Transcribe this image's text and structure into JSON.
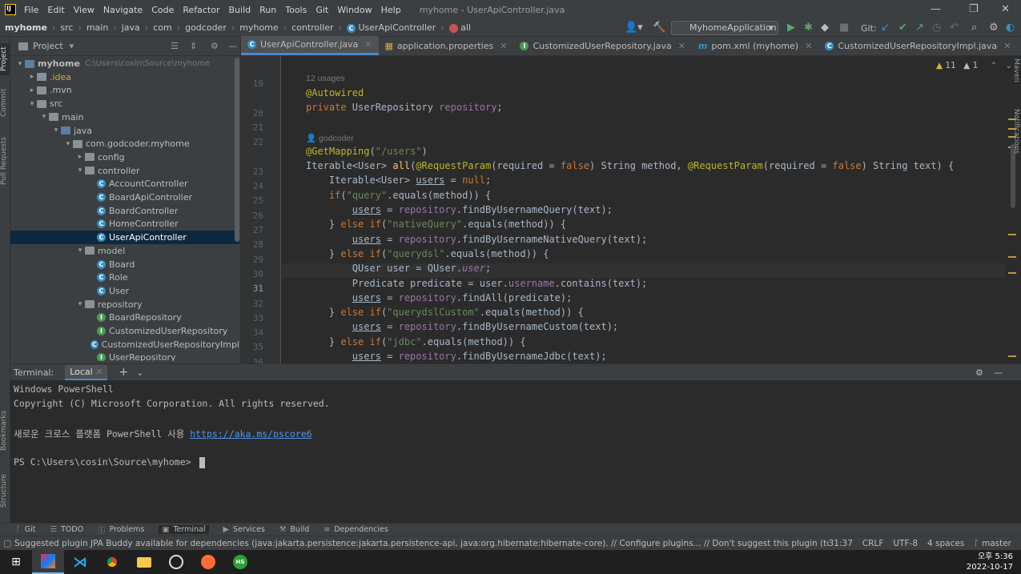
{
  "titlebar": {
    "menu": [
      "File",
      "Edit",
      "View",
      "Navigate",
      "Code",
      "Refactor",
      "Build",
      "Run",
      "Tools",
      "Git",
      "Window",
      "Help"
    ],
    "window_title": "myhome - UserApiController.java"
  },
  "navbar": {
    "crumbs": [
      "myhome",
      "src",
      "main",
      "java",
      "com",
      "godcoder",
      "myhome",
      "controller",
      "UserApiController",
      "all"
    ],
    "run_config": "MyhomeApplication",
    "git_label": "Git:"
  },
  "sidebar_labels": {
    "project": "Project",
    "commit": "Commit",
    "pull_requests": "Pull Requests",
    "bookmarks": "Bookmarks",
    "structure": "Structure"
  },
  "right_labels": {
    "maven": "Maven",
    "notifications": "Notifications"
  },
  "project": {
    "title": "Project",
    "tree": [
      {
        "label": "myhome",
        "extra": "C:\\Users\\cosin\\Source\\myhome",
        "indent": 0,
        "arrow": "v",
        "icon": "folder-blue",
        "bold": true
      },
      {
        "label": ".idea",
        "indent": 1,
        "arrow": ">",
        "icon": "folder",
        "color": "#d0a93d"
      },
      {
        "label": ".mvn",
        "indent": 1,
        "arrow": ">",
        "icon": "folder"
      },
      {
        "label": "src",
        "indent": 1,
        "arrow": "v",
        "icon": "folder"
      },
      {
        "label": "main",
        "indent": 2,
        "arrow": "v",
        "icon": "folder"
      },
      {
        "label": "java",
        "indent": 3,
        "arrow": "v",
        "icon": "folder-blue"
      },
      {
        "label": "com.godcoder.myhome",
        "indent": 4,
        "arrow": "v",
        "icon": "folder"
      },
      {
        "label": "config",
        "indent": 5,
        "arrow": ">",
        "icon": "folder"
      },
      {
        "label": "controller",
        "indent": 5,
        "arrow": "v",
        "icon": "folder"
      },
      {
        "label": "AccountController",
        "indent": 6,
        "arrow": "",
        "icon": "class"
      },
      {
        "label": "BoardApiController",
        "indent": 6,
        "arrow": "",
        "icon": "class"
      },
      {
        "label": "BoardController",
        "indent": 6,
        "arrow": "",
        "icon": "class"
      },
      {
        "label": "HomeController",
        "indent": 6,
        "arrow": "",
        "icon": "class"
      },
      {
        "label": "UserApiController",
        "indent": 6,
        "arrow": "",
        "icon": "class",
        "selected": true
      },
      {
        "label": "model",
        "indent": 5,
        "arrow": "v",
        "icon": "folder"
      },
      {
        "label": "Board",
        "indent": 6,
        "arrow": "",
        "icon": "class"
      },
      {
        "label": "Role",
        "indent": 6,
        "arrow": "",
        "icon": "class"
      },
      {
        "label": "User",
        "indent": 6,
        "arrow": "",
        "icon": "class"
      },
      {
        "label": "repository",
        "indent": 5,
        "arrow": "v",
        "icon": "folder"
      },
      {
        "label": "BoardRepository",
        "indent": 6,
        "arrow": "",
        "icon": "interface"
      },
      {
        "label": "CustomizedUserRepository",
        "indent": 6,
        "arrow": "",
        "icon": "interface"
      },
      {
        "label": "CustomizedUserRepositoryImpl",
        "indent": 6,
        "arrow": "",
        "icon": "class"
      },
      {
        "label": "UserRepository",
        "indent": 6,
        "arrow": "",
        "icon": "interface"
      }
    ]
  },
  "tabs": [
    {
      "label": "UserApiController.java",
      "icon": "class",
      "active": true
    },
    {
      "label": "application.properties",
      "icon": "props"
    },
    {
      "label": "CustomizedUserRepository.java",
      "icon": "interface"
    },
    {
      "label": "pom.xml (myhome)",
      "icon": "maven"
    },
    {
      "label": "CustomizedUserRepositoryImpl.java",
      "icon": "class"
    }
  ],
  "inspections": {
    "warnings": "11",
    "weak": "1"
  },
  "code_lines": [
    {
      "n": "19",
      "html": ""
    },
    {
      "hint": "12 usages"
    },
    {
      "n": "20",
      "html": "<span class='ann'>@Autowired</span>"
    },
    {
      "n": "21",
      "html": "<span class='kw'>private </span>UserRepository <span class='fld'>repository</span>;"
    },
    {
      "n": "22",
      "html": ""
    },
    {
      "hint": "godcoder"
    },
    {
      "n": "23",
      "html": "<span class='ann'>@GetMapping</span>(<span class='str'>\"/users\"</span>)"
    },
    {
      "n": "24",
      "html": "Iterable&lt;User&gt; <span style='color:#ffc66d'>all</span>(<span class='ann'>@RequestParam</span>(required = <span class='kw'>false</span>) String method, <span class='ann'>@RequestParam</span>(required = <span class='kw'>false</span>) String text) {"
    },
    {
      "n": "25",
      "html": "    Iterable&lt;User&gt; <span class='ul'>users</span> = <span class='kw'>null</span>;"
    },
    {
      "n": "26",
      "html": "    <span class='kw'>if</span>(<span class='str'>\"query\"</span>.equals(method)) {"
    },
    {
      "n": "27",
      "html": "        <span class='ul'>users</span> = <span class='fld'>repository</span>.findByUsernameQuery(text);"
    },
    {
      "n": "28",
      "html": "    } <span class='kw'>else if</span>(<span class='str'>\"nativeQuery\"</span>.equals(method)) {"
    },
    {
      "n": "29",
      "html": "        <span class='ul'>users</span> = <span class='fld'>repository</span>.findByUsernameNativeQuery(text);"
    },
    {
      "n": "30",
      "html": "    } <span class='kw'>else if</span>(<span class='str'>\"querydsl\"</span>.equals(method)) {"
    },
    {
      "n": "31",
      "html": "        QUser user = QUser.<span class='fld' style='font-style:italic'>user</span>;"
    },
    {
      "n": "32",
      "html": "        Predicate predicate = user.<span class='fld'>username</span>.contains(text);"
    },
    {
      "n": "33",
      "html": "        <span class='ul'>users</span> = <span class='fld'>repository</span>.findAll(predicate);"
    },
    {
      "n": "34",
      "html": "    } <span class='kw'>else if</span>(<span class='str'>\"querydslCustom\"</span>.equals(method)) {"
    },
    {
      "n": "35",
      "html": "        <span class='ul'>users</span> = <span class='fld'>repository</span>.findByUsernameCustom(text);"
    },
    {
      "n": "36",
      "html": "    } <span class='kw'>else if</span>(<span class='str'>\"jdbc\"</span>.equals(method)) {"
    },
    {
      "n": "37",
      "html": "        <span class='ul'>users</span> = <span class='fld'>repository</span>.findByUsernameJdbc(text);"
    }
  ],
  "terminal": {
    "title": "Terminal:",
    "tab": "Local",
    "lines": [
      "Windows PowerShell",
      "Copyright (C) Microsoft Corporation. All rights reserved.",
      "",
      "새로운 크로스 플랫폼 PowerShell 사용 ",
      "",
      "PS C:\\Users\\cosin\\Source\\myhome> "
    ],
    "link": "https://aka.ms/pscore6"
  },
  "toolwindows": [
    "Git",
    "TODO",
    "Problems",
    "Terminal",
    "Services",
    "Build",
    "Dependencies"
  ],
  "status": {
    "message": "Suggested plugin JPA Buddy available for dependencies (java:jakarta.persistence:jakarta.persistence-api, java:org.hibernate:hibernate-core). // Configure plugins... // Don't suggest this plugin (today 오후 2:52)",
    "position": "31:37",
    "line_sep": "CRLF",
    "encoding": "UTF-8",
    "indent": "4 spaces",
    "branch": "master"
  },
  "clock": {
    "time": "오후 5:36",
    "date": "2022-10-17"
  },
  "colors": {
    "accent": "#4a88c7",
    "selection": "#0d293e"
  }
}
